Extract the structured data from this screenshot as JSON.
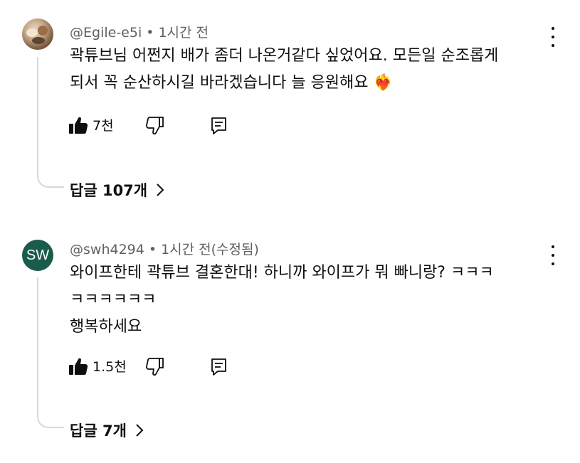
{
  "comments": [
    {
      "author": "@Egile-e5i",
      "separator": "•",
      "time": "1시간 전",
      "text_lines": [
        "곽튜브님 어쩐지 배가 좀더 나온거같다 싶었어요. 모든일 순조롭게",
        "되서 꼭 순산하시길 바라겠습니다 늘 응원해요 ❤️‍🔥"
      ],
      "likes": "7천",
      "replies_label": "답글 107개"
    },
    {
      "author": "@swh4294",
      "separator": "•",
      "time": "1시간 전(수정됨)",
      "avatar_initials": "SW",
      "text_lines": [
        "와이프한테 곽튜브 결혼한대! 하니까 와이프가 뭐 빠니랑? ㅋㅋㅋ",
        "ㅋㅋㅋㅋㅋㅋ",
        "행복하세요"
      ],
      "likes": "1.5천",
      "replies_label": "답글 7개"
    }
  ],
  "icons": {
    "like": "thumbs-up-filled-icon",
    "dislike": "thumbs-down-outline-icon",
    "reply": "comment-reply-icon",
    "more": "more-vertical-icon",
    "chevron": "chevron-right-icon"
  },
  "colors": {
    "text": "#0f0f0f",
    "meta": "#606060",
    "avatar_sw_bg": "#1a5c4b",
    "thread_line": "#d9d9d9"
  }
}
